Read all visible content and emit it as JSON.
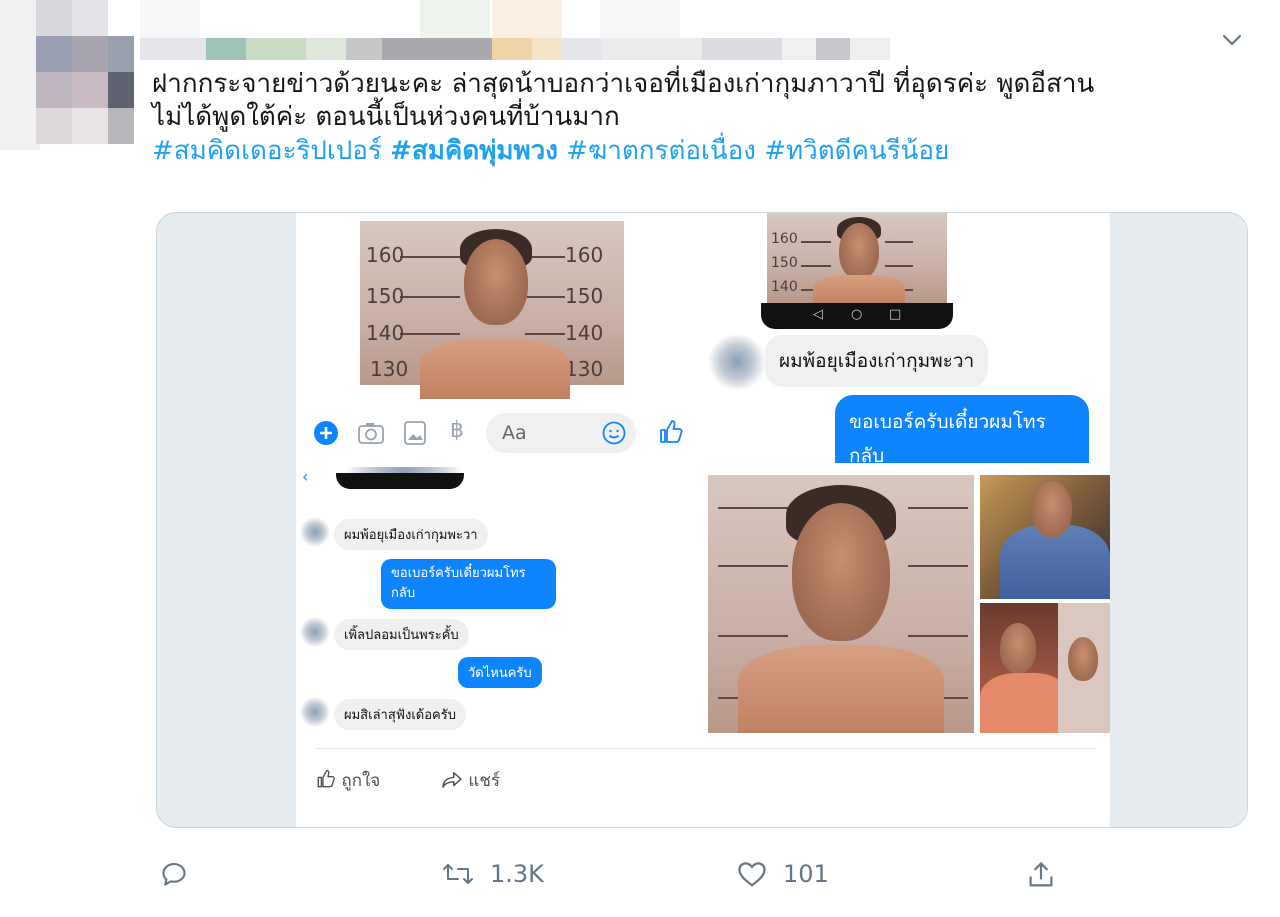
{
  "tweet": {
    "text_line1": "ฝากกระจายข่าวด้วยนะคะ ล่าสุดน้าบอกว่าเจอที่เมืองเก่ากุมภาวาปี ที่อุดรค่ะ พูดอีสาน",
    "text_line2": "ไม่ได้พูดใต้ค่ะ ตอนนี้เป็นห่วงคนที่บ้านมาก",
    "hashtags": [
      "#สมคิดเดอะริปเปอร์",
      "#สมคิดพุ่มพวง",
      "#ฆาตกรต่อเนื่อง",
      "#ทวิตดีคนรีน้อย"
    ]
  },
  "media": {
    "mugshot_top_left": {
      "scale": [
        "160",
        "150",
        "140",
        "130"
      ],
      "scale_right": [
        "160",
        "150",
        "140",
        "130"
      ]
    },
    "composer": {
      "placeholder": "Aa"
    },
    "chat_top_right": {
      "scale": [
        "160",
        "150",
        "140"
      ],
      "incoming": "ผมพ้อยุเมืองเก่ากุมพะวา",
      "outgoing": "ขอเบอร์ครับเดี๋ยวผมโทร กลับ"
    },
    "chat_bottom_left": {
      "messages": [
        {
          "side": "left",
          "text": "ผมพ้อยุเมืองเก่ากุมพะวา"
        },
        {
          "side": "right",
          "text": "ขอเบอร์ครับเดี๋ยวผมโทร กลับ"
        },
        {
          "side": "left",
          "text": "เพิ้ลปลอมเป็นพระคั้บ"
        },
        {
          "side": "right",
          "text": "วัดไหนครับ"
        },
        {
          "side": "left",
          "text": "ผมสิเล่าสุฟังเด้อครับ"
        }
      ]
    },
    "fb_actions": {
      "like": "ถูกใจ",
      "share": "แชร์"
    }
  },
  "actions": {
    "retweets": "1.3K",
    "likes": "101"
  },
  "colors": {
    "link": "#1da1f2",
    "messenger_blue": "#0f84ff",
    "muted": "#657786"
  }
}
